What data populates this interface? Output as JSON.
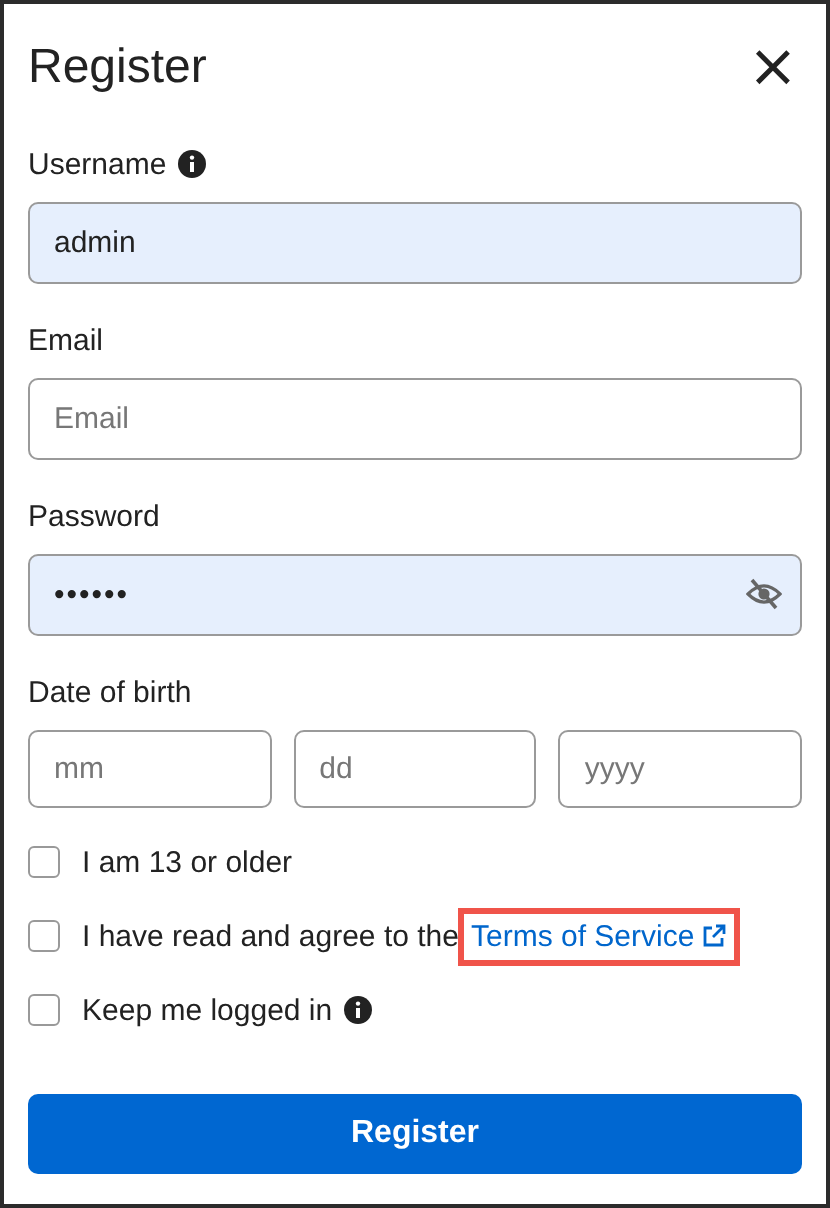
{
  "dialog": {
    "title": "Register",
    "close": "×"
  },
  "fields": [
    {
      "kind": "text",
      "label": "Username",
      "info": true,
      "value": "admin",
      "autofilled": true
    },
    {
      "kind": "text",
      "label": "Email",
      "info": false,
      "placeholder": "Email",
      "autofilled": false
    },
    {
      "kind": "password",
      "label": "Password",
      "info": false,
      "value": "••••••",
      "autofilled": true
    }
  ],
  "date_of_birth": {
    "label": "Date of birth",
    "parts": [
      {
        "placeholder": "mm"
      },
      {
        "placeholder": "dd"
      },
      {
        "placeholder": "yyyy"
      }
    ]
  },
  "checkboxes": [
    {
      "label": "I am 13 or older",
      "checked": false
    },
    {
      "label": "I have read and agree to the",
      "link": "Terms of Service",
      "link_highlighted": true,
      "checked": false
    },
    {
      "label": "Keep me logged in",
      "info": true,
      "checked": false
    }
  ],
  "submit": "Register"
}
